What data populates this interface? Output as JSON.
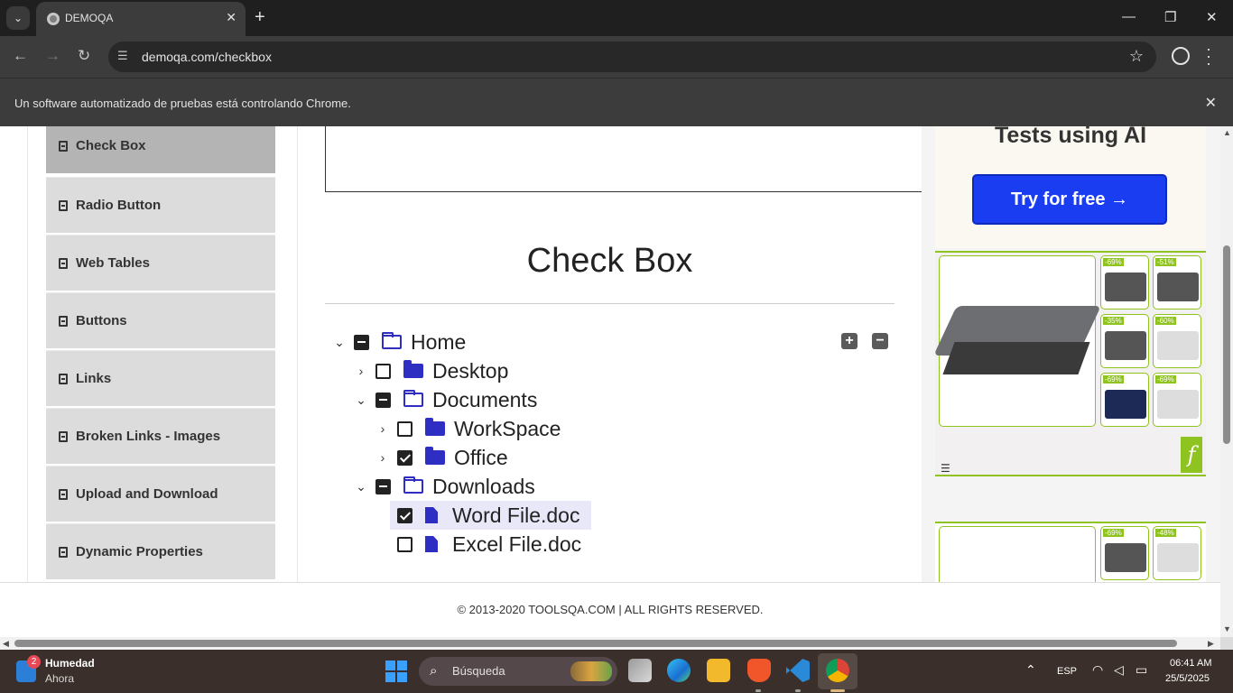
{
  "browser": {
    "tab_title": "DEMOQA",
    "url": "demoqa.com/checkbox",
    "infobar_text": "Un software automatizado de pruebas está controlando Chrome."
  },
  "sidebar": {
    "items": [
      {
        "label": "Check Box",
        "active": true
      },
      {
        "label": "Radio Button"
      },
      {
        "label": "Web Tables"
      },
      {
        "label": "Buttons"
      },
      {
        "label": "Links"
      },
      {
        "label": "Broken Links - Images"
      },
      {
        "label": "Upload and Download"
      },
      {
        "label": "Dynamic Properties"
      }
    ]
  },
  "main": {
    "title": "Check Box",
    "tree": [
      {
        "label": "Home",
        "state": "half",
        "expanded": true,
        "type": "folder-open"
      },
      {
        "label": "Desktop",
        "state": "unchecked",
        "expanded": false,
        "type": "folder"
      },
      {
        "label": "Documents",
        "state": "half",
        "expanded": true,
        "type": "folder-open"
      },
      {
        "label": "WorkSpace",
        "state": "unchecked",
        "expanded": false,
        "type": "folder"
      },
      {
        "label": "Office",
        "state": "checked",
        "expanded": false,
        "type": "folder"
      },
      {
        "label": "Downloads",
        "state": "half",
        "expanded": true,
        "type": "folder-open"
      },
      {
        "label": "Word File.doc",
        "state": "checked",
        "type": "file",
        "highlight": true
      },
      {
        "label": "Excel File.doc",
        "state": "unchecked",
        "type": "file"
      }
    ],
    "expand_all_label": "+",
    "collapse_all_label": "−"
  },
  "ad": {
    "headline": "Tests using AI",
    "cta": "Try for free →",
    "thumbs_top": [
      "-69%",
      "-51%",
      "-35%",
      "-60%",
      "-69%",
      "-69%"
    ],
    "thumbs_bottom": [
      "-69%",
      "-48%"
    ],
    "logo": "f",
    "accent": "#8fc31f"
  },
  "footer": {
    "text": "© 2013-2020 TOOLSQA.COM | ALL RIGHTS RESERVED."
  },
  "taskbar": {
    "weather_badge": "2",
    "weather_title": "Humedad",
    "weather_sub": "Ahora",
    "search_placeholder": "Búsqueda",
    "lang": "ESP",
    "time": "06:41 AM",
    "date": "25/5/2025"
  }
}
